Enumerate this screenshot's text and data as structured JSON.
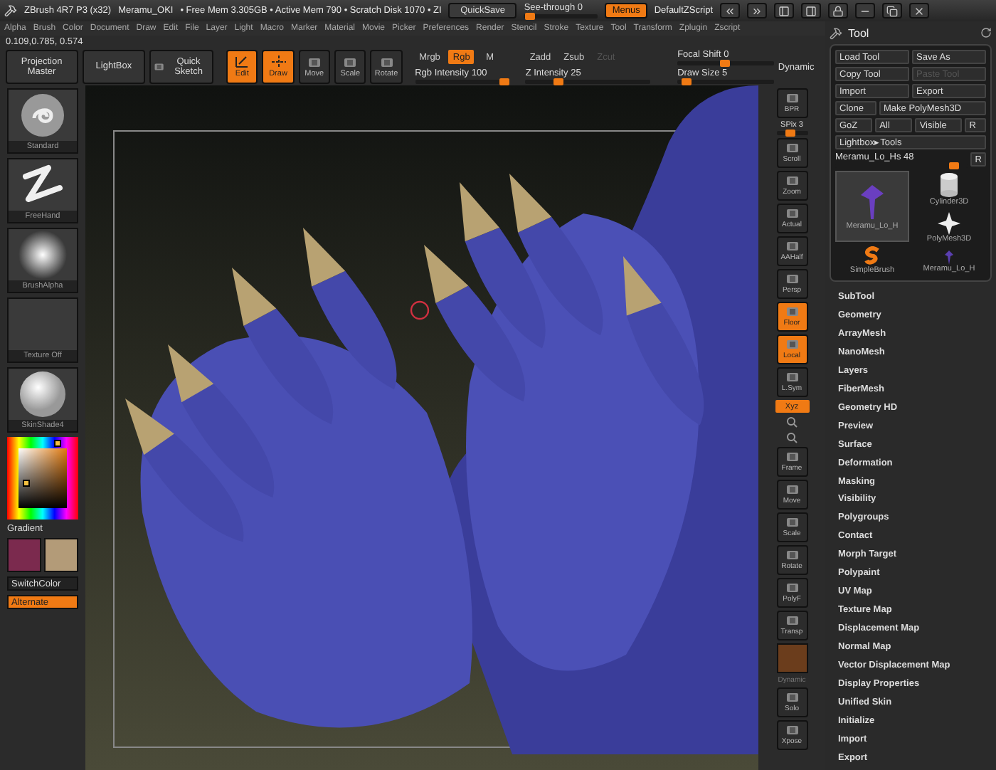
{
  "title_bar": {
    "app": "ZBrush 4R7 P3 (x32)",
    "document": "Meramu_OKI",
    "stats": "• Free Mem 3.305GB • Active Mem 790 • Scratch Disk 1070 • ZI",
    "quicksave": "QuickSave",
    "see_through": {
      "label": "See-through 0",
      "level": 0.02
    },
    "menus": {
      "label": "Menus",
      "on": true
    },
    "script": "DefaultZScript"
  },
  "menu_bar": [
    "Alpha",
    "Brush",
    "Color",
    "Document",
    "Draw",
    "Edit",
    "File",
    "Layer",
    "Light",
    "Macro",
    "Marker",
    "Material",
    "Movie",
    "Picker",
    "Preferences",
    "Render",
    "Stencil",
    "Stroke",
    "Texture",
    "Tool",
    "Transform",
    "Zplugin",
    "Zscript"
  ],
  "coordinates": "0.109,0.785, 0.574",
  "shelf": {
    "panels": [
      "Projection Master",
      "LightBox",
      "Quick Sketch"
    ],
    "tools": [
      {
        "label": "Edit",
        "on": true
      },
      {
        "label": "Draw",
        "on": true
      },
      {
        "label": "Move",
        "on": false
      },
      {
        "label": "Scale",
        "on": false
      },
      {
        "label": "Rotate",
        "on": false
      }
    ],
    "color_modes": [
      {
        "label": "Mrgb",
        "on": false
      },
      {
        "label": "Rgb",
        "on": true
      },
      {
        "label": "M",
        "on": false
      }
    ],
    "rgb_intensity": {
      "label": "Rgb Intensity 100",
      "level": 1
    },
    "depth_modes": [
      {
        "label": "Zadd",
        "disabled": false
      },
      {
        "label": "Zsub",
        "disabled": false
      },
      {
        "label": "Zcut",
        "disabled": true
      }
    ],
    "z_intensity": {
      "label": "Z Intensity 25",
      "level": 0.25
    },
    "focal_shift": {
      "label": "Focal Shift 0",
      "level": 0.5
    },
    "draw_size": {
      "label": "Draw Size 5",
      "level": 0.05
    },
    "dynamic": "Dynamic"
  },
  "left_shelf": {
    "thumbs": [
      {
        "label": "Standard",
        "kind": "brush"
      },
      {
        "label": "FreeHand",
        "kind": "stroke"
      },
      {
        "label": "BrushAlpha",
        "kind": "alpha"
      },
      {
        "label": "Texture Off",
        "kind": "empty"
      },
      {
        "label": "SkinShade4",
        "kind": "material"
      }
    ],
    "gradient": "Gradient",
    "swatches": [
      {
        "color": "#7b2a4e"
      },
      {
        "color": "#b39b78"
      }
    ],
    "switch_color": "SwitchColor",
    "alternate": {
      "label": "Alternate",
      "on": true
    }
  },
  "right_shelf": [
    {
      "kind": "button",
      "label": "BPR",
      "on": false
    },
    {
      "kind": "slider",
      "label": "SPix 3",
      "level": 0.45
    },
    {
      "kind": "button",
      "label": "Scroll",
      "on": false
    },
    {
      "kind": "button",
      "label": "Zoom",
      "on": false
    },
    {
      "kind": "button",
      "label": "Actual",
      "on": false
    },
    {
      "kind": "button",
      "label": "AAHalf",
      "on": false
    },
    {
      "kind": "button",
      "label": "Persp",
      "on": false
    },
    {
      "kind": "button",
      "label": "Floor",
      "on": true
    },
    {
      "kind": "button",
      "label": "Local",
      "on": true
    },
    {
      "kind": "button",
      "label": "L.Sym",
      "on": false
    },
    {
      "kind": "toggle",
      "label": "Xyz",
      "on": true
    },
    {
      "kind": "mini"
    },
    {
      "kind": "mini"
    },
    {
      "kind": "button",
      "label": "Frame",
      "on": false
    },
    {
      "kind": "button",
      "label": "Move",
      "on": false
    },
    {
      "kind": "button",
      "label": "Scale",
      "on": false
    },
    {
      "kind": "button",
      "label": "Rotate",
      "on": false
    },
    {
      "kind": "button",
      "label": "PolyF",
      "on": false
    },
    {
      "kind": "button",
      "label": "Transp",
      "on": false
    },
    {
      "kind": "blank"
    },
    {
      "kind": "caption",
      "label": "Dynamic"
    },
    {
      "kind": "button",
      "label": "Solo",
      "on": false
    },
    {
      "kind": "button",
      "label": "Xpose",
      "on": false
    }
  ],
  "tool_panel": {
    "title": "Tool",
    "button_rows": [
      [
        {
          "label": "Load Tool",
          "disabled": false
        },
        {
          "label": "Save As",
          "disabled": false
        }
      ],
      [
        {
          "label": "Copy Tool",
          "disabled": false
        },
        {
          "label": "Paste Tool",
          "disabled": true
        }
      ],
      [
        {
          "label": "Import",
          "disabled": false
        },
        {
          "label": "Export",
          "disabled": false
        }
      ],
      [
        {
          "label": "Clone",
          "disabled": false
        },
        {
          "label": "Make PolyMesh3D",
          "disabled": false
        }
      ],
      [
        {
          "label": "GoZ",
          "disabled": false
        },
        {
          "label": "All",
          "disabled": false
        },
        {
          "label": "Visible",
          "disabled": false
        },
        {
          "label": "R",
          "disabled": false
        }
      ],
      [
        {
          "label": "Lightbox▸Tools",
          "disabled": false
        }
      ]
    ],
    "tool_slider": {
      "label": "Meramu_Lo_Hs 48",
      "level": 0.93,
      "reset": "R"
    },
    "tools": [
      {
        "label": "Meramu_Lo_H",
        "kind": "mesh",
        "selected": true
      },
      {
        "label": "SimpleBrush",
        "kind": "brush",
        "selected": false
      },
      {
        "label": "Cylinder3D",
        "kind": "cylinder",
        "selected": false
      },
      {
        "label": "PolyMesh3D",
        "kind": "star",
        "selected": false
      },
      {
        "label": "Meramu_Lo_H",
        "kind": "mesh-small",
        "selected": false
      }
    ],
    "menu": [
      "SubTool",
      "Geometry",
      "ArrayMesh",
      "NanoMesh",
      "Layers",
      "FiberMesh",
      "Geometry HD",
      "Preview",
      "Surface",
      "Deformation",
      "Masking",
      "Visibility",
      "Polygroups",
      "Contact",
      "Morph Target",
      "Polypaint",
      "UV Map",
      "Texture Map",
      "Displacement Map",
      "Normal Map",
      "Vector Displacement Map",
      "Display Properties",
      "Unified Skin",
      "Initialize",
      "Import",
      "Export"
    ]
  }
}
